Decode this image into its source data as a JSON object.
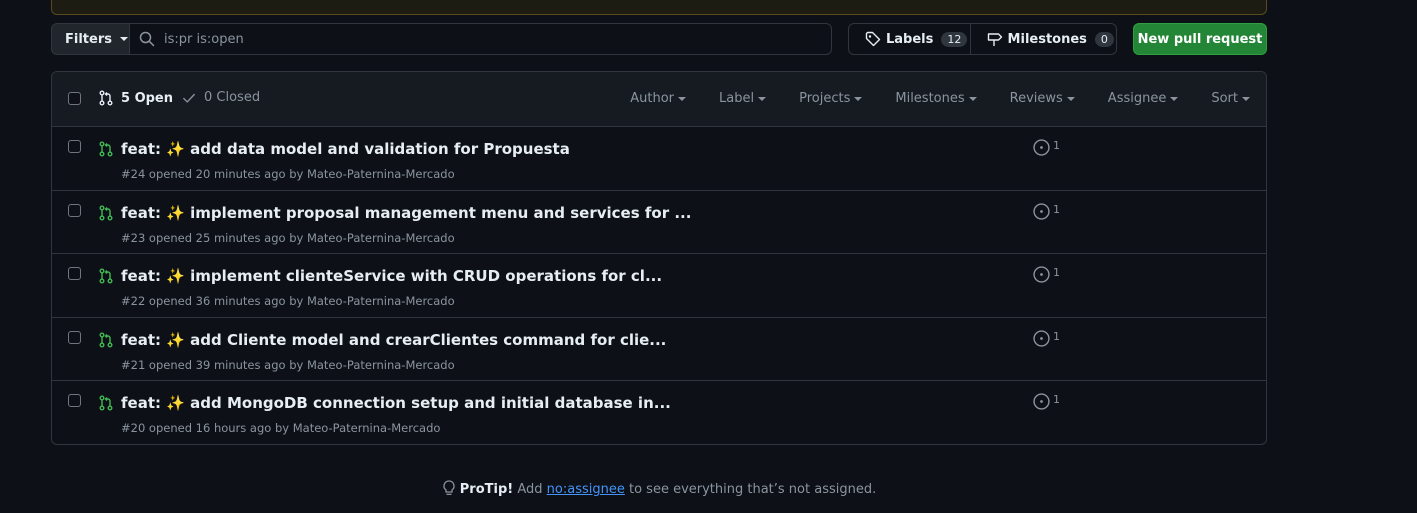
{
  "toolbar": {
    "filters_label": "Filters",
    "search_value": "is:pr is:open",
    "labels_label": "Labels",
    "labels_count": "12",
    "milestones_label": "Milestones",
    "milestones_count": "0",
    "new_pr_label": "New pull request"
  },
  "header": {
    "open_label": "5 Open",
    "closed_label": "0 Closed",
    "filters": [
      "Author",
      "Label",
      "Projects",
      "Milestones",
      "Reviews",
      "Assignee",
      "Sort"
    ]
  },
  "pull_requests": [
    {
      "prefix": "feat:",
      "emoji": "✨",
      "title": "add data model and validation for Propuesta",
      "meta": "#24 opened 20 minutes ago by Mateo-Paternina-Mercado",
      "linked": "1"
    },
    {
      "prefix": "feat:",
      "emoji": "✨",
      "title": "implement proposal management menu and services for ...",
      "meta": "#23 opened 25 minutes ago by Mateo-Paternina-Mercado",
      "linked": "1"
    },
    {
      "prefix": "feat:",
      "emoji": "✨",
      "title": "implement clienteService with CRUD operations for cl...",
      "meta": "#22 opened 36 minutes ago by Mateo-Paternina-Mercado",
      "linked": "1"
    },
    {
      "prefix": "feat:",
      "emoji": "✨",
      "title": "add Cliente model and crearClientes command for clie...",
      "meta": "#21 opened 39 minutes ago by Mateo-Paternina-Mercado",
      "linked": "1"
    },
    {
      "prefix": "feat:",
      "emoji": "✨",
      "title": "add MongoDB connection setup and initial database in...",
      "meta": "#20 opened 16 hours ago by Mateo-Paternina-Mercado",
      "linked": "1"
    }
  ],
  "protip": {
    "lead": "ProTip!",
    "before": "Add",
    "link": "no:assignee",
    "after": "to see everything that’s not assigned."
  },
  "colors": {
    "background": "#0d1117",
    "accent_green": "#238636",
    "open_icon": "#3fb950",
    "link": "#4493f8"
  }
}
